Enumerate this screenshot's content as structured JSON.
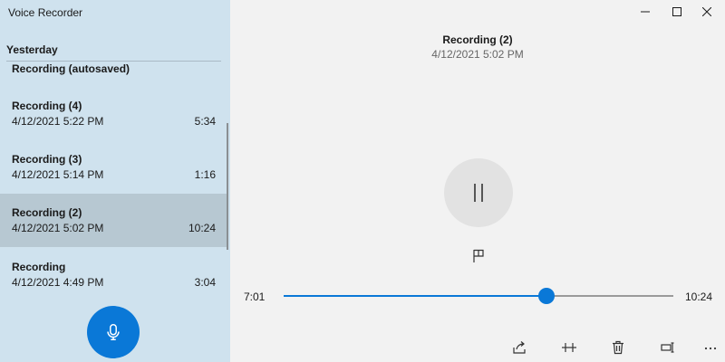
{
  "app": {
    "title": "Voice Recorder"
  },
  "sidebar": {
    "group_header": "Yesterday",
    "recordings": [
      {
        "name": "Recording (autosaved)",
        "date": "",
        "duration": ""
      },
      {
        "name": "Recording (4)",
        "date": "4/12/2021 5:22 PM",
        "duration": "5:34"
      },
      {
        "name": "Recording (3)",
        "date": "4/12/2021 5:14 PM",
        "duration": "1:16"
      },
      {
        "name": "Recording (2)",
        "date": "4/12/2021 5:02 PM",
        "duration": "10:24",
        "selected": true
      },
      {
        "name": "Recording",
        "date": "4/12/2021 4:49 PM",
        "duration": "3:04"
      }
    ],
    "record_icon": "microphone-icon"
  },
  "window_controls": [
    "minimize-icon",
    "maximize-icon",
    "close-icon"
  ],
  "player": {
    "title": "Recording (2)",
    "date": "4/12/2021 5:02 PM",
    "elapsed": "7:01",
    "total": "10:24",
    "progress_fraction": 0.675,
    "pause_icon": "pause-icon",
    "marker_icon": "flag-icon"
  },
  "toolbar": [
    "share-icon",
    "trim-icon",
    "delete-icon",
    "rename-icon",
    "more-icon"
  ],
  "colors": {
    "accent": "#0a78d7",
    "sidebar_bg": "#cfe2ee",
    "selected_bg": "#b7c8d2",
    "main_bg": "#f2f2f2"
  }
}
